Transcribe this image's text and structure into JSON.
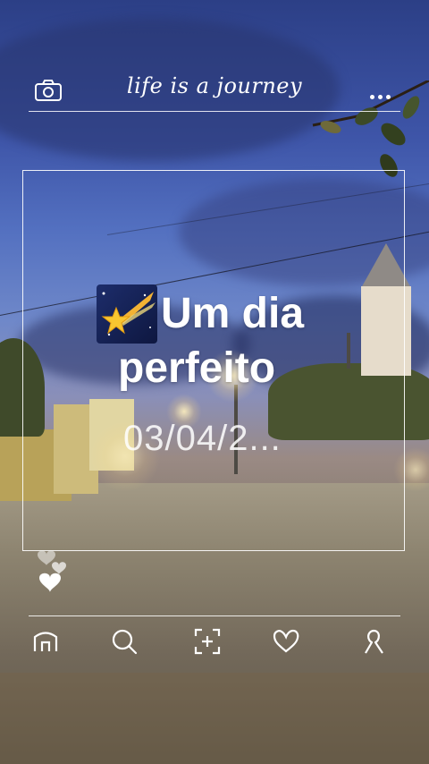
{
  "header": {
    "title": "life is a journey",
    "camera_icon": "camera-icon",
    "more_icon": "more-dots-icon"
  },
  "caption": {
    "emoji": "shooting-star-emoji",
    "line1": "Um dia",
    "line2": "perfeito",
    "date": "03/04/2..."
  },
  "reactions": {
    "icon": "hearts-icon"
  },
  "nav": {
    "items": [
      {
        "icon": "home-icon"
      },
      {
        "icon": "search-icon"
      },
      {
        "icon": "add-photo-icon"
      },
      {
        "icon": "heart-icon"
      },
      {
        "icon": "profile-icon"
      }
    ]
  },
  "colors": {
    "sky_top": "#2c3f86",
    "sky_mid": "#6f88c9",
    "street": "#8d8470",
    "overlay_text": "#ffffff"
  }
}
